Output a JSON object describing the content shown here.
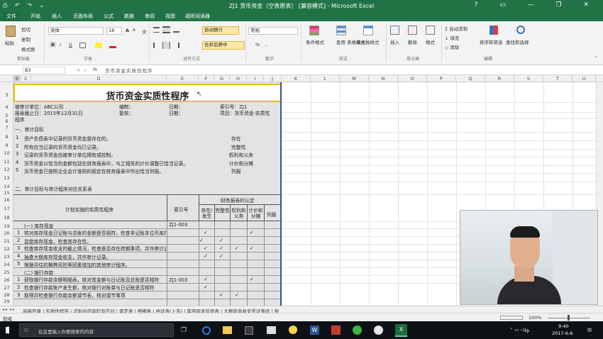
{
  "window": {
    "title": "ZJ1 货币资金（空表原表） [兼容模式] - Microsoft Excel",
    "quick_access": "⎙ ↶ ↷ ⌄",
    "controls": "? ▭ — ❐ ✕"
  },
  "ribbon_tabs": [
    "文件",
    "开始",
    "插入",
    "页面布局",
    "公式",
    "数据",
    "审阅",
    "视图",
    "福昕阅读器"
  ],
  "ribbon": {
    "clipboard": {
      "paste": "粘贴",
      "cut": "剪切",
      "copy": "复制",
      "format_painter": "格式刷",
      "group": "剪贴板"
    },
    "font": {
      "name": "宋体",
      "size": "18",
      "bold": "B",
      "italic": "I",
      "underline": "U",
      "group": "字体",
      "grow": "A",
      "shrink": "A",
      "wen": "文"
    },
    "alignment": {
      "wrap": "自动换行",
      "merge": "合并后居中",
      "group": "对齐方式"
    },
    "number": {
      "format": "常规",
      "percent": "%",
      "comma": ",",
      "group": "数字"
    },
    "styles": {
      "cond": "条件格式",
      "table": "套用\n表格格式",
      "cell": "单元格样式",
      "group": "样式"
    },
    "cells": {
      "insert": "插入",
      "delete": "删除",
      "format": "格式",
      "group": "单元格"
    },
    "editing": {
      "autosum": "自动求和",
      "fill": "填充",
      "clear": "清除",
      "sort": "排序和筛选",
      "find": "查找和选择",
      "group": "编辑"
    }
  },
  "formula_bar": {
    "name_box": "B3",
    "fx": "fx",
    "content": "货币资金实质性程序"
  },
  "columns": [
    "B",
    "C",
    "D",
    "E",
    "F",
    "G",
    "H",
    "I",
    "J",
    "K",
    "L",
    "M",
    "N",
    "O",
    "P",
    "Q",
    "R",
    "S",
    "T",
    "U"
  ],
  "rows": [
    "3",
    "4",
    "5",
    "6",
    "7",
    "8",
    "9",
    "10",
    "11",
    "12",
    "13",
    "14",
    "15",
    "16",
    "17",
    "18",
    "19",
    "20",
    "21",
    "22",
    "23",
    "24",
    "25",
    "26",
    "27",
    "28",
    "29",
    "30"
  ],
  "sheet": {
    "title": "货币资金实质性程序",
    "info": {
      "client": "被审计单位：ABC公司",
      "preparer": "编制：",
      "date1": "日期：",
      "index": "索引号：ZJ1",
      "period": "报表截止日：2015年12月31日",
      "reviewer": "复核：",
      "date2": "日期：",
      "project": "项目：货币资金-实质性",
      "project2": "程序"
    },
    "section1": "一、审计目标",
    "objectives": [
      {
        "no": "1",
        "text": "资产负债表中记录的货币资金是存在的。",
        "assert": "存在"
      },
      {
        "no": "2",
        "text": "所有应当记录的货币资金均已记录。",
        "assert": "完整性"
      },
      {
        "no": "3",
        "text": "记录的货币资金由被审计单位拥有或控制。",
        "assert": "权利和义务"
      },
      {
        "no": "4",
        "text": "货币资金以恰当的金额包括在财务报表中，与之相关的计价调整已恰当记录。",
        "assert": "计价和分摊"
      },
      {
        "no": "5",
        "text": "货币资金已按照企业会计准则的规定在财务报表中作出恰当列报。",
        "assert": "列报"
      }
    ],
    "section2": "二、审计目标与审计程序对应关系表",
    "table_head": {
      "plan": "计划实施的实质性程序",
      "index": "索引号",
      "group": "财务报表的认定",
      "c1": "存在/发生",
      "c2": "完整性",
      "c3": "权利和义务",
      "c4": "计价和分摊",
      "c5": "列报"
    },
    "rows": [
      {
        "text": "(一) 库存现金",
        "index": "ZJ1-003"
      },
      {
        "text": "核对库存现金日记账与总账的金额是否相符，检查非记账本位币库存",
        "no": "1"
      },
      {
        "text": "监盘库存现金，检查其存在性。",
        "no": "2"
      },
      {
        "text": "检查库存现金收支的截止情况，检查是否存在跨期事项，并作审计调",
        "no": "3"
      },
      {
        "text": "抽查大额库存现金收支，并作审计记录。",
        "no": "4"
      },
      {
        "text": "根据评估的舞弊风险等因素增加的其他审计程序。",
        "no": "5"
      },
      {
        "text": "(二) 银行存款"
      },
      {
        "text": "获取银行存款余额明细表，核对其金额与日记账及总账是否相符",
        "no": "1",
        "index": "ZJ1-003"
      },
      {
        "text": "检查银行存款账户发生额，核对银行对账单与日记账是否相符",
        "no": "2"
      },
      {
        "text": "取得并检查银行存款余额调节表，核对调节事项",
        "no": "3"
      }
    ],
    "check": "✓"
  },
  "sheet_tabs": "底稿目录 | 实质性程序 | 识别出的风险及应对 | 审定表 | 明细表 | 函证表(上市) | 库存现金监盘表 | 大额现金收支凭证查验 | 银",
  "status": {
    "left": "就绪",
    "zoom": "100%"
  },
  "taskbar": {
    "search": "在这里输入你要搜索的内容",
    "time": "9:40",
    "date": "2017-6-6",
    "ime": "中"
  }
}
